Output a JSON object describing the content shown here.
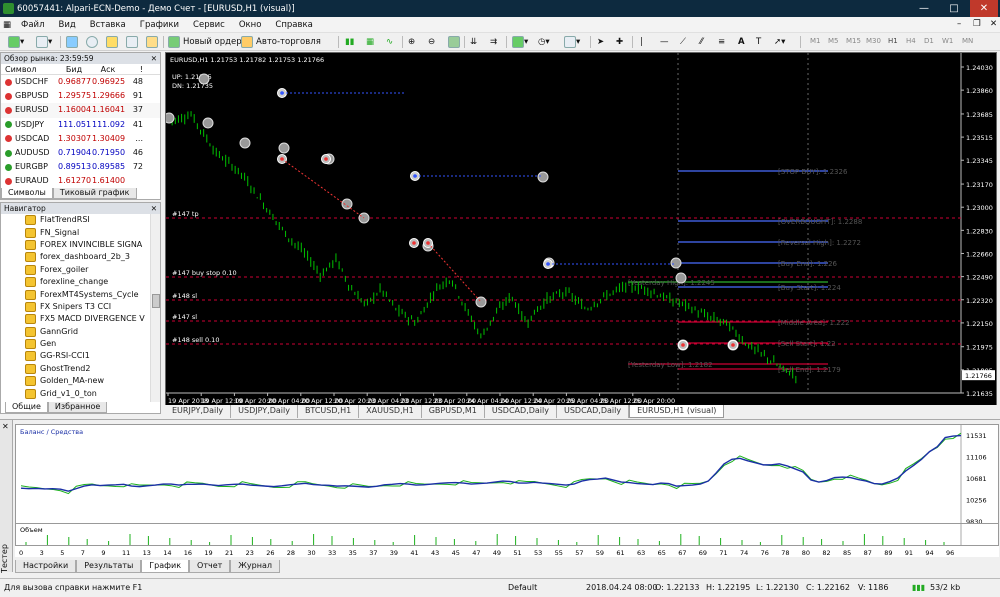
{
  "window": {
    "title": "60057441: Alpari-ECN-Demo - Демо Счет - [EURUSD,H1 (visual)]"
  },
  "menu": [
    "Файл",
    "Вид",
    "Вставка",
    "Графики",
    "Сервис",
    "Окно",
    "Справка"
  ],
  "toolbar": {
    "new_order": "Новый ордер",
    "autotrading": "Авто-торговля",
    "timeframes": [
      "M1",
      "M5",
      "M15",
      "M30",
      "H1",
      "H4",
      "D1",
      "W1",
      "MN"
    ]
  },
  "market_watch": {
    "title": "Обзор рынка: 23:59:59",
    "col_symbol": "Символ",
    "col_bid": "Бид",
    "col_ask": "Аск",
    "col_spread": "!",
    "rows": [
      {
        "symbol": "USDCHF",
        "bid": "0.96877",
        "ask": "0.96925",
        "spread": "48",
        "dir": "down"
      },
      {
        "symbol": "GBPUSD",
        "bid": "1.29575",
        "ask": "1.29666",
        "spread": "91",
        "dir": "down"
      },
      {
        "symbol": "EURUSD",
        "bid": "1.16004",
        "ask": "1.16041",
        "spread": "37",
        "dir": "down"
      },
      {
        "symbol": "USDJPY",
        "bid": "111.051",
        "ask": "111.092",
        "spread": "41",
        "dir": "up"
      },
      {
        "symbol": "USDCAD",
        "bid": "1.30307",
        "ask": "1.30409",
        "spread": "...",
        "dir": "down"
      },
      {
        "symbol": "AUDUSD",
        "bid": "0.71904",
        "ask": "0.71950",
        "spread": "46",
        "dir": "up"
      },
      {
        "symbol": "EURGBP",
        "bid": "0.89513",
        "ask": "0.89585",
        "spread": "72",
        "dir": "up"
      },
      {
        "symbol": "EURAUD",
        "bid": "1.61270",
        "ask": "1.61400",
        "spread": "",
        "dir": "down"
      }
    ],
    "tab_symbols": "Символы",
    "tab_tick": "Тиковый график"
  },
  "navigator": {
    "title": "Навигатор",
    "items": [
      "FlatTrendRSI",
      "FN_Signal",
      "FOREX INVINCIBLE SIGNA",
      "forex_dashboard_2b_3",
      "Forex_goiler",
      "forexline_change",
      "ForexMT4Systems_Cycle",
      "FX Snipers T3 CCI",
      "FX5 MACD DIVERGENCE V",
      "GannGrid",
      "Gen",
      "GG-RSI-CCI1",
      "GhostTrend2",
      "Golden_MA-new",
      "Grid_v1_0_ton"
    ],
    "tab_general": "Общие",
    "tab_favorites": "Избранное"
  },
  "chart": {
    "header": "EURUSD,H1  1.21753 1.21782 1.21753 1.21766",
    "up_label": "UP: 1.21795",
    "dn_label": "DN: 1.21735",
    "price_ticks": [
      "1.24030",
      "1.23860",
      "1.23685",
      "1.23515",
      "1.23345",
      "1.23170",
      "1.23000",
      "1.22830",
      "1.22660",
      "1.22490",
      "1.22320",
      "1.22150",
      "1.21975",
      "1.21805",
      "1.21635"
    ],
    "current_price": "1.21766",
    "time_ticks": [
      "19 Apr 2018",
      "19 Apr 12:00",
      "19 Apr 20:00",
      "20 Apr 04:00",
      "20 Apr 12:00",
      "20 Apr 20:00",
      "23 Apr 04:00",
      "23 Apr 12:00",
      "23 Apr 20:00",
      "24 Apr 04:00",
      "24 Apr 12:00",
      "24 Apr 20:00",
      "25 Apr 04:00",
      "25 Apr 12:00",
      "25 Apr 20:00"
    ],
    "left_labels": [
      "#147 tp",
      "#147 buy stop 0.10",
      "#148 sl",
      "#147 sl",
      "#148 sell 0.10"
    ],
    "right_levels": [
      "[STOP BUY]: 1.2326",
      "[OVERBOUGHT]: 1.2288",
      "[Reversal High]: 1.2272",
      "[Buy End]: 1.226",
      "[Yesterday High]: 1.2245",
      "[Buy Start]: 1.224",
      "[Middle Area]: 1.222",
      "[Sell Start]: 1.22",
      "[Yesterday Low]: 1.2182",
      "[Sell End]: 1.2179"
    ],
    "colors": {
      "bull": "#00c000",
      "bear": "#00c000",
      "bg": "#000000"
    }
  },
  "chart_tabs": [
    "EURJPY,Daily",
    "USDJPY,Daily",
    "BTCUSD,H1",
    "XAUUSD,H1",
    "GBPUSD,M1",
    "USDCAD,Daily",
    "USDCAD,Daily",
    "EURUSD,H1 (visual)"
  ],
  "tester": {
    "legend": "Баланс / Средства",
    "volume_label": "Объем",
    "balance_ticks": [
      "11531",
      "11106",
      "10681",
      "10256",
      "9830"
    ],
    "x_ticks": [
      "0",
      "3",
      "5",
      "7",
      "9",
      "11",
      "13",
      "14",
      "16",
      "19",
      "21",
      "23",
      "26",
      "28",
      "30",
      "33",
      "35",
      "37",
      "39",
      "41",
      "43",
      "45",
      "47",
      "49",
      "51",
      "53",
      "55",
      "57",
      "59",
      "61",
      "63",
      "65",
      "67",
      "69",
      "71",
      "74",
      "76",
      "78",
      "80",
      "82",
      "85",
      "87",
      "89",
      "91",
      "94",
      "96"
    ],
    "tabs": [
      "Настройки",
      "Результаты",
      "График",
      "Отчет",
      "Журнал"
    ],
    "side_label": "Тестер"
  },
  "status": {
    "help": "Для вызова справки нажмите F1",
    "profile": "Default",
    "datetime": "2018.04.24 08:00",
    "open": "O: 1.22133",
    "high": "H: 1.22195",
    "low": "L: 1.22130",
    "close": "C: 1.22162",
    "volume": "V: 1186",
    "traffic": "53/2 kb"
  }
}
